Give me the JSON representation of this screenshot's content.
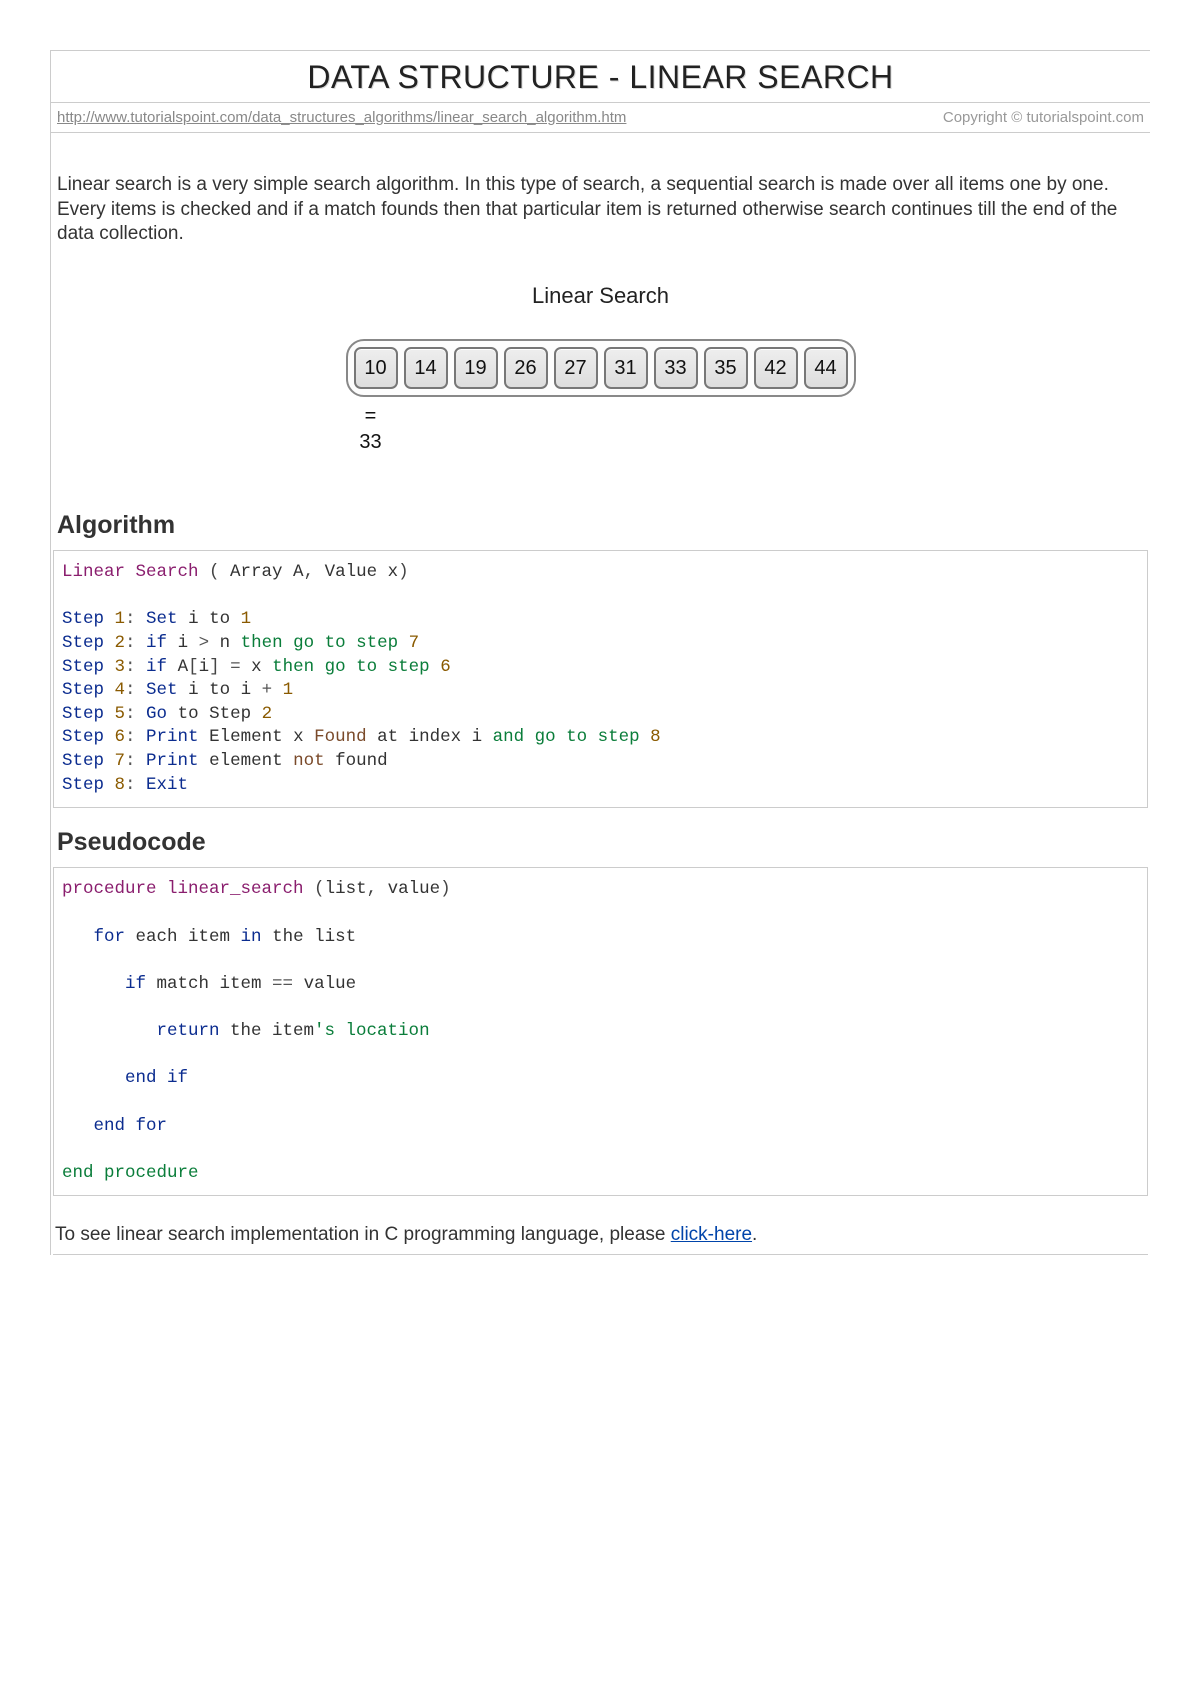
{
  "header": {
    "title": "DATA STRUCTURE - LINEAR SEARCH",
    "url": "http://www.tutorialspoint.com/data_structures_algorithms/linear_search_algorithm.htm",
    "copyright": "Copyright © tutorialspoint.com"
  },
  "intro": "Linear search is a very simple search algorithm. In this type of search, a sequential search is made over all items one by one. Every items is checked and if a match founds then that particular item is returned otherwise search continues till the end of the data collection.",
  "diagram": {
    "title": "Linear Search",
    "cells": [
      "10",
      "14",
      "19",
      "26",
      "27",
      "31",
      "33",
      "35",
      "42",
      "44"
    ],
    "eq": "=",
    "target": "33"
  },
  "sections": {
    "algorithm_heading": "Algorithm",
    "pseudocode_heading": "Pseudocode"
  },
  "algorithm": {
    "l0_a": "Linear Search ",
    "l0_b": "(",
    "l0_c": " Array A",
    "l0_d": ",",
    "l0_e": " Value x",
    "l0_f": ")",
    "s1a": "Step ",
    "s1n": "1",
    "s1c": ":",
    "s1d": " Set",
    "s1e": " i to ",
    "s1f": "1",
    "s2a": "Step ",
    "s2n": "2",
    "s2c": ":",
    "s2d": " if",
    "s2e": " i ",
    "s2f": ">",
    "s2g": " n ",
    "s2h": "then go to step ",
    "s2i": "7",
    "s3a": "Step ",
    "s3n": "3",
    "s3c": ":",
    "s3d": " if",
    "s3e": " A",
    "s3f": "[",
    "s3g": "i",
    "s3h": "]",
    "s3i": " =",
    "s3j": " x ",
    "s3k": "then go to step ",
    "s3l": "6",
    "s4a": "Step ",
    "s4n": "4",
    "s4c": ":",
    "s4d": " Set",
    "s4e": " i to i ",
    "s4f": "+",
    "s4g": " ",
    "s4h": "1",
    "s5a": "Step ",
    "s5n": "5",
    "s5c": ":",
    "s5d": " Go",
    "s5e": " to Step ",
    "s5f": "2",
    "s6a": "Step ",
    "s6n": "6",
    "s6c": ":",
    "s6d": " Print",
    "s6e": " Element x ",
    "s6f": "Found",
    "s6g": " at index i ",
    "s6h": "and go to step ",
    "s6i": "8",
    "s7a": "Step ",
    "s7n": "7",
    "s7c": ":",
    "s7d": " Print",
    "s7e": " element ",
    "s7f": "not",
    "s7g": " found",
    "s8a": "Step ",
    "s8n": "8",
    "s8c": ":",
    "s8d": " Exit"
  },
  "pseudocode": {
    "p1a": "procedure linear_search ",
    "p1b": "(",
    "p1c": "list",
    "p1d": ",",
    "p1e": " value",
    "p1f": ")",
    "p2a": "   for",
    "p2b": " each item ",
    "p2c": "in",
    "p2d": " the list",
    "p3a": "      if",
    "p3b": " match item ",
    "p3c": "==",
    "p3d": " value",
    "p4a": "         return",
    "p4b": " the item",
    "p4c": "'s location",
    "p5a": "      end if",
    "p6a": "   end for",
    "p7a": "end procedure"
  },
  "footer": {
    "text_before": "To see linear search implementation in C programming language, please ",
    "link_text": "click-here",
    "text_after": "."
  }
}
